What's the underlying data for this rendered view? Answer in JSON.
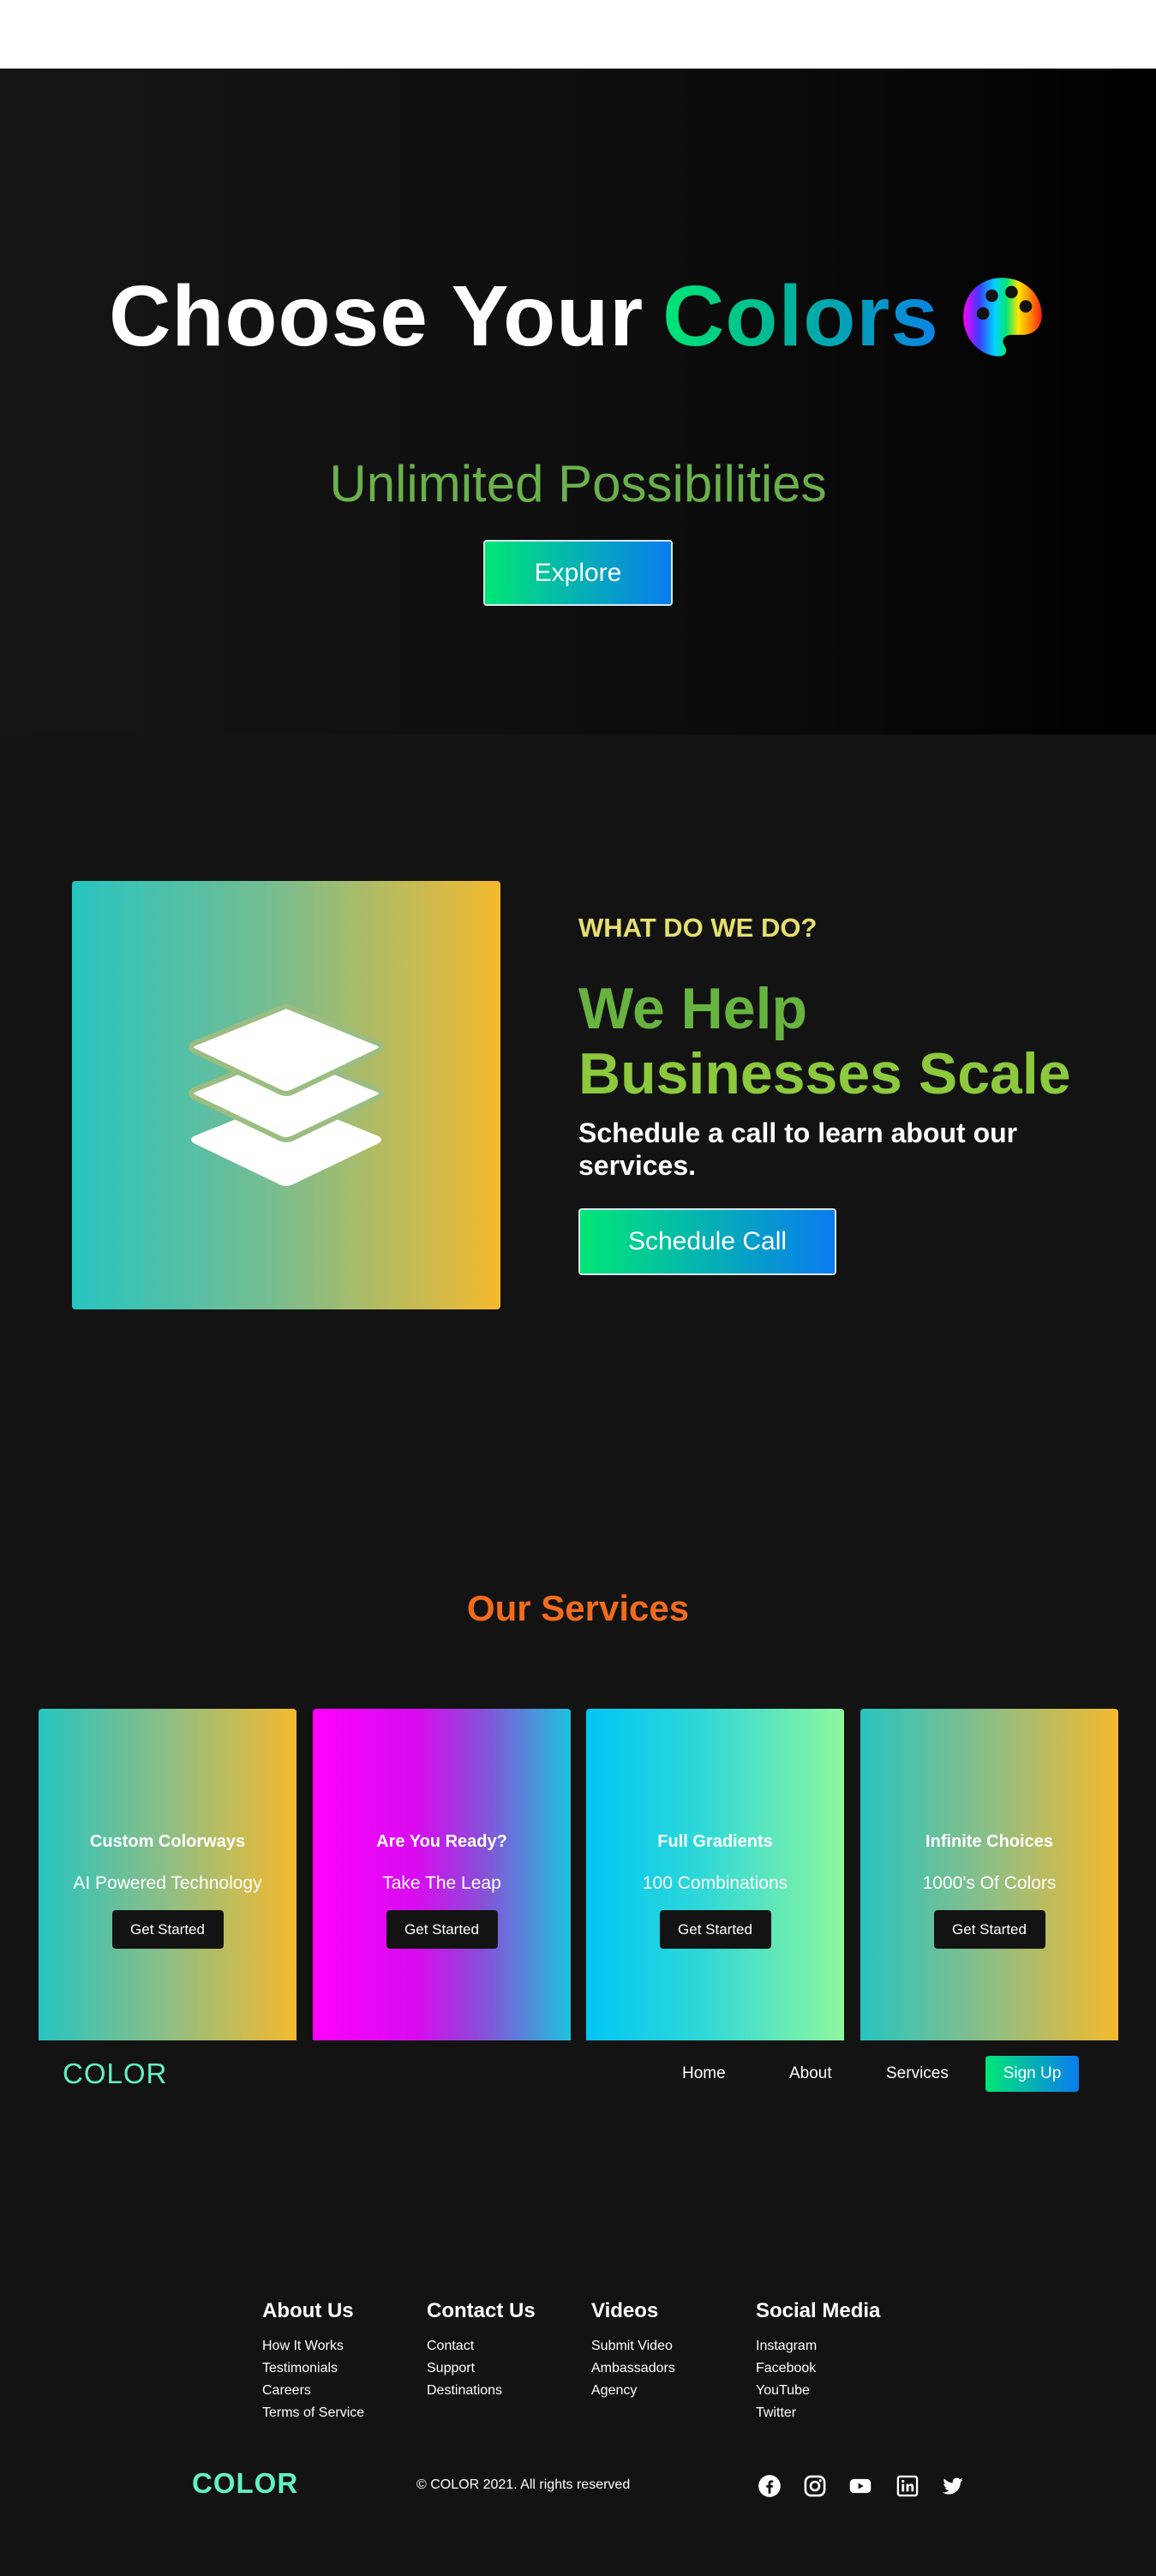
{
  "hero": {
    "title_part1": "Choose Your",
    "title_part2": "Colors",
    "subtitle": "Unlimited Possibilities",
    "button": "Explore"
  },
  "about": {
    "kicker": "WHAT DO WE DO?",
    "heading_line1": "We Help",
    "heading_line2": "Businesses Scale",
    "text": "Schedule a call to learn about our services.",
    "button": "Schedule Call"
  },
  "services": {
    "title": "Our Services",
    "cards": [
      {
        "title": "Custom Colorways",
        "subtitle": "AI Powered Technology",
        "button": "Get Started"
      },
      {
        "title": "Are You Ready?",
        "subtitle": "Take The Leap",
        "button": "Get Started"
      },
      {
        "title": "Full Gradients",
        "subtitle": "100 Combinations",
        "button": "Get Started"
      },
      {
        "title": "Infinite Choices",
        "subtitle": "1000's Of Colors",
        "button": "Get Started"
      }
    ]
  },
  "navbar": {
    "logo": "COLOR",
    "links": [
      "Home",
      "About",
      "Services"
    ],
    "signup": "Sign Up"
  },
  "footer": {
    "columns": [
      {
        "heading": "About Us",
        "links": [
          "How It Works",
          "Testimonials",
          "Careers",
          "Terms of Service"
        ]
      },
      {
        "heading": "Contact Us",
        "links": [
          "Contact",
          "Support",
          "Destinations"
        ]
      },
      {
        "heading": "Videos",
        "links": [
          "Submit Video",
          "Ambassadors",
          "Agency"
        ]
      },
      {
        "heading": "Social Media",
        "links": [
          "Instagram",
          "Facebook",
          "YouTube",
          "Twitter"
        ]
      }
    ],
    "logo": "COLOR",
    "copyright": "© COLOR 2021. All rights reserved",
    "social_icons": [
      "facebook-icon",
      "instagram-icon",
      "youtube-icon",
      "linkedin-icon",
      "twitter-icon"
    ]
  },
  "colors": {
    "background": "#131313",
    "accent_green": "#00e676",
    "accent_blue": "#0a7cf0",
    "heading_green": "#67b340",
    "kicker_yellow": "#e6df6f",
    "services_orange": "#f26b1d",
    "logo_teal": "#62f2c2"
  }
}
